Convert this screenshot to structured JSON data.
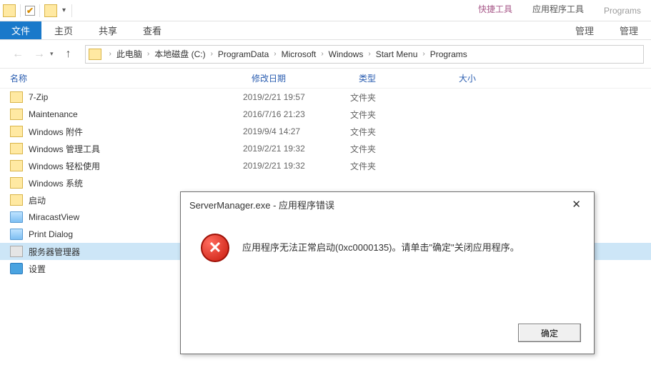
{
  "titlebar": {
    "quick_tools": "快捷工具",
    "app_tools": "应用程序工具",
    "programs": "Programs"
  },
  "ribbon": {
    "file": "文件",
    "home": "主页",
    "share": "共享",
    "view": "查看",
    "manage1": "管理",
    "manage2": "管理"
  },
  "breadcrumb": {
    "items": [
      "此电脑",
      "本地磁盘 (C:)",
      "ProgramData",
      "Microsoft",
      "Windows",
      "Start Menu",
      "Programs"
    ]
  },
  "cols": {
    "name": "名称",
    "date": "修改日期",
    "type": "类型",
    "size": "大小"
  },
  "rows": [
    {
      "name": "7-Zip",
      "date": "2019/2/21 19:57",
      "type": "文件夹",
      "icon": "folder"
    },
    {
      "name": "Maintenance",
      "date": "2016/7/16 21:23",
      "type": "文件夹",
      "icon": "folder"
    },
    {
      "name": "Windows 附件",
      "date": "2019/9/4 14:27",
      "type": "文件夹",
      "icon": "folder"
    },
    {
      "name": "Windows 管理工具",
      "date": "2019/2/21 19:32",
      "type": "文件夹",
      "icon": "folder"
    },
    {
      "name": "Windows 轻松使用",
      "date": "2019/2/21 19:32",
      "type": "文件夹",
      "icon": "folder"
    },
    {
      "name": "Windows 系统",
      "date": "",
      "type": "",
      "icon": "folder"
    },
    {
      "name": "启动",
      "date": "",
      "type": "",
      "icon": "folder"
    },
    {
      "name": "MiracastView",
      "date": "",
      "type": "",
      "icon": "app"
    },
    {
      "name": "Print Dialog",
      "date": "",
      "type": "",
      "icon": "app"
    },
    {
      "name": "服务器管理器",
      "date": "",
      "type": "",
      "icon": "srv",
      "selected": true
    },
    {
      "name": "设置",
      "date": "",
      "type": "",
      "icon": "gear"
    }
  ],
  "dialog": {
    "title": "ServerManager.exe - 应用程序错误",
    "message": "应用程序无法正常启动(0xc0000135)。请单击\"确定\"关闭应用程序。",
    "ok": "确定"
  }
}
